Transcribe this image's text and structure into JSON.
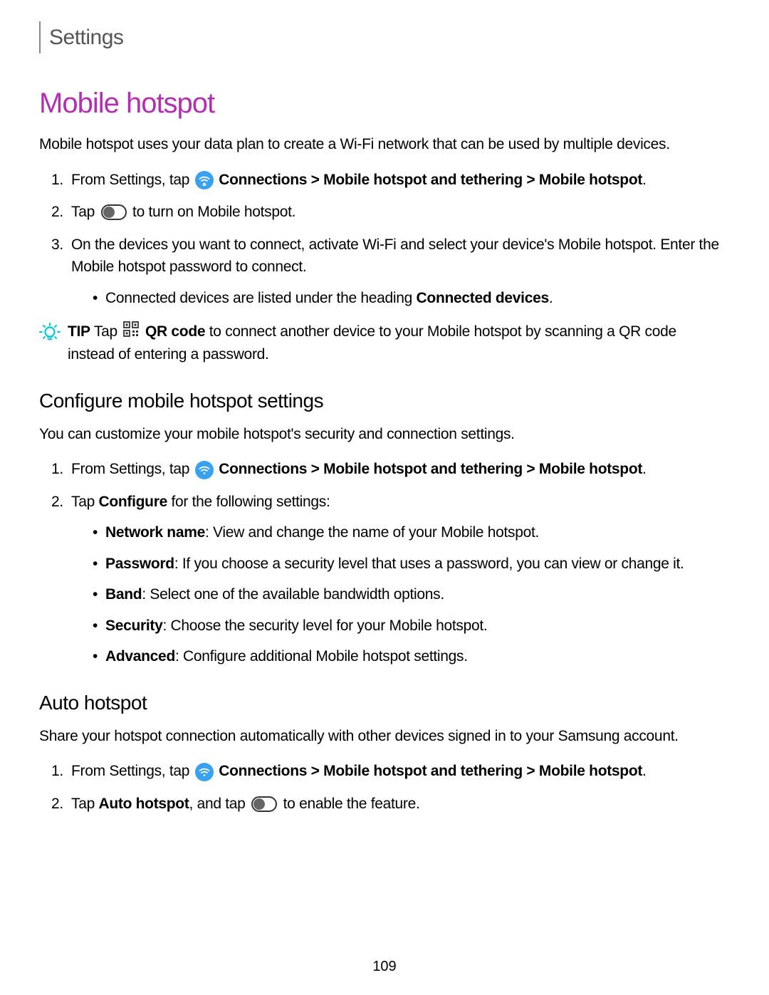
{
  "header": {
    "title": "Settings"
  },
  "main": {
    "title": "Mobile hotspot",
    "intro": "Mobile hotspot uses your data plan to create a Wi-Fi network that can be used by multiple devices.",
    "steps": {
      "s1_pre": "From Settings, tap ",
      "s1_bold1": "Connections > Mobile hotspot and tethering > Mobile hotspot",
      "s1_post": ".",
      "s2_pre": "Tap ",
      "s2_post": " to turn on Mobile hotspot.",
      "s3": "On the devices you want to connect, activate Wi-Fi and select your device's Mobile hotspot. Enter the Mobile hotspot password to connect.",
      "s3_sub_pre": "Connected devices are listed under the heading ",
      "s3_sub_bold": "Connected devices",
      "s3_sub_post": "."
    },
    "tip": {
      "label": "TIP",
      "pre": "  Tap ",
      "bold": "QR code",
      "post": " to connect another device to your Mobile hotspot by scanning a QR code instead of entering a password."
    }
  },
  "configure": {
    "title": "Configure mobile hotspot settings",
    "intro": "You can customize your mobile hotspot's security and connection settings.",
    "steps": {
      "s1_pre": "From Settings, tap ",
      "s1_bold": "Connections > Mobile hotspot and tethering > Mobile hotspot",
      "s1_post": ".",
      "s2_pre": "Tap ",
      "s2_bold": "Configure",
      "s2_post": " for the following settings:"
    },
    "options": {
      "o1_bold": "Network name",
      "o1_text": ": View and change the name of your Mobile hotspot.",
      "o2_bold": "Password",
      "o2_text": ": If you choose a security level that uses a password, you can view or change it.",
      "o3_bold": "Band",
      "o3_text": ": Select one of the available bandwidth options.",
      "o4_bold": "Security",
      "o4_text": ": Choose the security level for your Mobile hotspot.",
      "o5_bold": "Advanced",
      "o5_text": ": Configure additional Mobile hotspot settings."
    }
  },
  "auto": {
    "title": "Auto hotspot",
    "intro": "Share your hotspot connection automatically with other devices signed in to your Samsung account.",
    "steps": {
      "s1_pre": "From Settings, tap ",
      "s1_bold": "Connections > Mobile hotspot and tethering > Mobile hotspot",
      "s1_post": ".",
      "s2_pre": "Tap ",
      "s2_bold": "Auto hotspot",
      "s2_mid": ", and tap ",
      "s2_post": " to enable the feature."
    }
  },
  "page_number": "109"
}
